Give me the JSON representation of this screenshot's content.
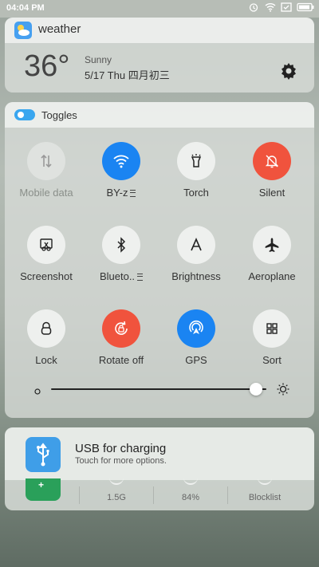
{
  "status_bar": {
    "time": "04:04 PM",
    "icons": [
      "alarm-icon",
      "wifi-icon",
      "battery-saver-icon",
      "battery-icon"
    ]
  },
  "weather": {
    "app_title": "weather",
    "temperature": "36°",
    "condition": "Sunny",
    "date_line": "5/17  Thu  四月初三",
    "settings_icon": "gear-icon"
  },
  "toggles": {
    "title": "Toggles",
    "items": [
      {
        "label": "Mobile data",
        "icon": "mobile-data-icon",
        "state": "disabled"
      },
      {
        "label": "BY-z",
        "icon": "wifi-icon",
        "state": "on",
        "has_menu": true
      },
      {
        "label": "Torch",
        "icon": "torch-icon",
        "state": "off"
      },
      {
        "label": "Silent",
        "icon": "bell-off-icon",
        "state": "on"
      },
      {
        "label": "Screenshot",
        "icon": "scissors-icon",
        "state": "off"
      },
      {
        "label": "Blueto..",
        "icon": "bluetooth-icon",
        "state": "off",
        "has_menu": true
      },
      {
        "label": "Brightness",
        "icon": "auto-brightness-icon",
        "state": "off"
      },
      {
        "label": "Aeroplane",
        "icon": "airplane-icon",
        "state": "off"
      },
      {
        "label": "Lock",
        "icon": "lock-icon",
        "state": "off"
      },
      {
        "label": "Rotate off",
        "icon": "rotate-lock-icon",
        "state": "on"
      },
      {
        "label": "GPS",
        "icon": "gps-icon",
        "state": "on"
      },
      {
        "label": "Sort",
        "icon": "grid-icon",
        "state": "off"
      }
    ],
    "brightness_level": 0.95,
    "colors": {
      "wifi_on": "#1a84f2",
      "silent_on": "#f0533d",
      "rotate_on": "#f0533d",
      "gps_on": "#1a84f2"
    }
  },
  "usb": {
    "title": "USB for charging",
    "subtitle": "Touch for more options.",
    "stats": [
      "1.5G",
      "84%",
      "Blocklist"
    ]
  }
}
